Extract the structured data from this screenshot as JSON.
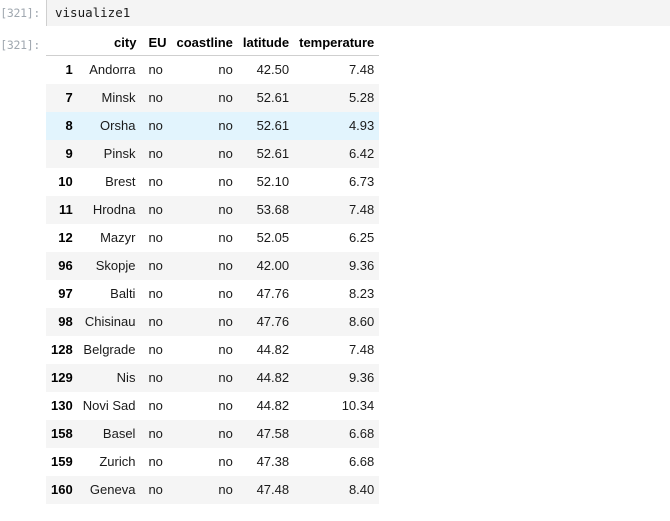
{
  "cell": {
    "input_prompt": "[321]:",
    "input_code": "visualize1",
    "output_prompt": "[321]:"
  },
  "table": {
    "index_header": "",
    "columns": [
      "city",
      "EU",
      "coastline",
      "latitude",
      "temperature"
    ],
    "rows": [
      {
        "index": "1",
        "city": "Andorra",
        "EU": "no",
        "coastline": "no",
        "latitude": "42.50",
        "temperature": "7.48",
        "highlight": false
      },
      {
        "index": "7",
        "city": "Minsk",
        "EU": "no",
        "coastline": "no",
        "latitude": "52.61",
        "temperature": "5.28",
        "highlight": false
      },
      {
        "index": "8",
        "city": "Orsha",
        "EU": "no",
        "coastline": "no",
        "latitude": "52.61",
        "temperature": "4.93",
        "highlight": true
      },
      {
        "index": "9",
        "city": "Pinsk",
        "EU": "no",
        "coastline": "no",
        "latitude": "52.61",
        "temperature": "6.42",
        "highlight": false
      },
      {
        "index": "10",
        "city": "Brest",
        "EU": "no",
        "coastline": "no",
        "latitude": "52.10",
        "temperature": "6.73",
        "highlight": false
      },
      {
        "index": "11",
        "city": "Hrodna",
        "EU": "no",
        "coastline": "no",
        "latitude": "53.68",
        "temperature": "7.48",
        "highlight": false
      },
      {
        "index": "12",
        "city": "Mazyr",
        "EU": "no",
        "coastline": "no",
        "latitude": "52.05",
        "temperature": "6.25",
        "highlight": false
      },
      {
        "index": "96",
        "city": "Skopje",
        "EU": "no",
        "coastline": "no",
        "latitude": "42.00",
        "temperature": "9.36",
        "highlight": false
      },
      {
        "index": "97",
        "city": "Balti",
        "EU": "no",
        "coastline": "no",
        "latitude": "47.76",
        "temperature": "8.23",
        "highlight": false
      },
      {
        "index": "98",
        "city": "Chisinau",
        "EU": "no",
        "coastline": "no",
        "latitude": "47.76",
        "temperature": "8.60",
        "highlight": false
      },
      {
        "index": "128",
        "city": "Belgrade",
        "EU": "no",
        "coastline": "no",
        "latitude": "44.82",
        "temperature": "7.48",
        "highlight": false
      },
      {
        "index": "129",
        "city": "Nis",
        "EU": "no",
        "coastline": "no",
        "latitude": "44.82",
        "temperature": "9.36",
        "highlight": false
      },
      {
        "index": "130",
        "city": "Novi Sad",
        "EU": "no",
        "coastline": "no",
        "latitude": "44.82",
        "temperature": "10.34",
        "highlight": false
      },
      {
        "index": "158",
        "city": "Basel",
        "EU": "no",
        "coastline": "no",
        "latitude": "47.58",
        "temperature": "6.68",
        "highlight": false
      },
      {
        "index": "159",
        "city": "Zurich",
        "EU": "no",
        "coastline": "no",
        "latitude": "47.38",
        "temperature": "6.68",
        "highlight": false
      },
      {
        "index": "160",
        "city": "Geneva",
        "EU": "no",
        "coastline": "no",
        "latitude": "47.48",
        "temperature": "8.40",
        "highlight": false
      }
    ]
  },
  "colors": {
    "prompt": "#a0a8b0",
    "input_bg": "#f4f4f4",
    "stripe": "#f5f5f5",
    "highlight_row": "#e2f4fd",
    "rule": "#cfcfcf"
  }
}
